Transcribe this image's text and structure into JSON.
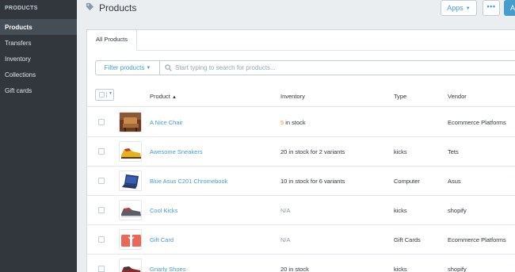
{
  "sidebar": {
    "header": "PRODUCTS",
    "items": [
      {
        "label": "Products"
      },
      {
        "label": "Transfers"
      },
      {
        "label": "Inventory"
      },
      {
        "label": "Collections"
      },
      {
        "label": "Gift cards"
      }
    ]
  },
  "topbar": {
    "title": "Products",
    "apps_label": "Apps",
    "more_label": "•••",
    "add_label": "A"
  },
  "tabs": [
    {
      "label": "All Products"
    }
  ],
  "filter": {
    "button_label": "Filter products",
    "search_placeholder": "Start typing to search for products..."
  },
  "table": {
    "columns": {
      "product": "Product",
      "inventory": "Inventory",
      "type": "Type",
      "vendor": "Vendor"
    },
    "rows": [
      {
        "name": "A Nice Chair",
        "inventory_num": "5",
        "inventory_rest": " in stock",
        "type": "",
        "vendor": "Ecommerce Platforms",
        "thumb": "chair"
      },
      {
        "name": "Awesome Sneakers",
        "inventory_num": "",
        "inventory_rest": "20 in stock for 2 variants",
        "type": "kicks",
        "vendor": "Tets",
        "thumb": "sneaker-yellow"
      },
      {
        "name": "Blue Asus C201 Chromebook",
        "inventory_num": "",
        "inventory_rest": "10 in stock for 6 variants",
        "type": "Computer",
        "vendor": "Asus",
        "thumb": "laptop"
      },
      {
        "name": "Cool Kicks",
        "inventory_num": "",
        "inventory_rest": "N/A",
        "type": "kicks",
        "vendor": "shopify",
        "thumb": "sneaker-grey"
      },
      {
        "name": "Gift Card",
        "inventory_num": "",
        "inventory_rest": "N/A",
        "type": "Gift Cards",
        "vendor": "Ecommerce Platforms",
        "thumb": "giftcard"
      },
      {
        "name": "Gnarly Shoes",
        "inventory_num": "",
        "inventory_rest": "20 in stock",
        "type": "kicks",
        "vendor": "shopify",
        "thumb": "sneaker-red"
      }
    ]
  },
  "colors": {
    "sidebar_bg": "#31373d",
    "accent": "#479ccf",
    "stock_warning": "#fc8b2e"
  }
}
